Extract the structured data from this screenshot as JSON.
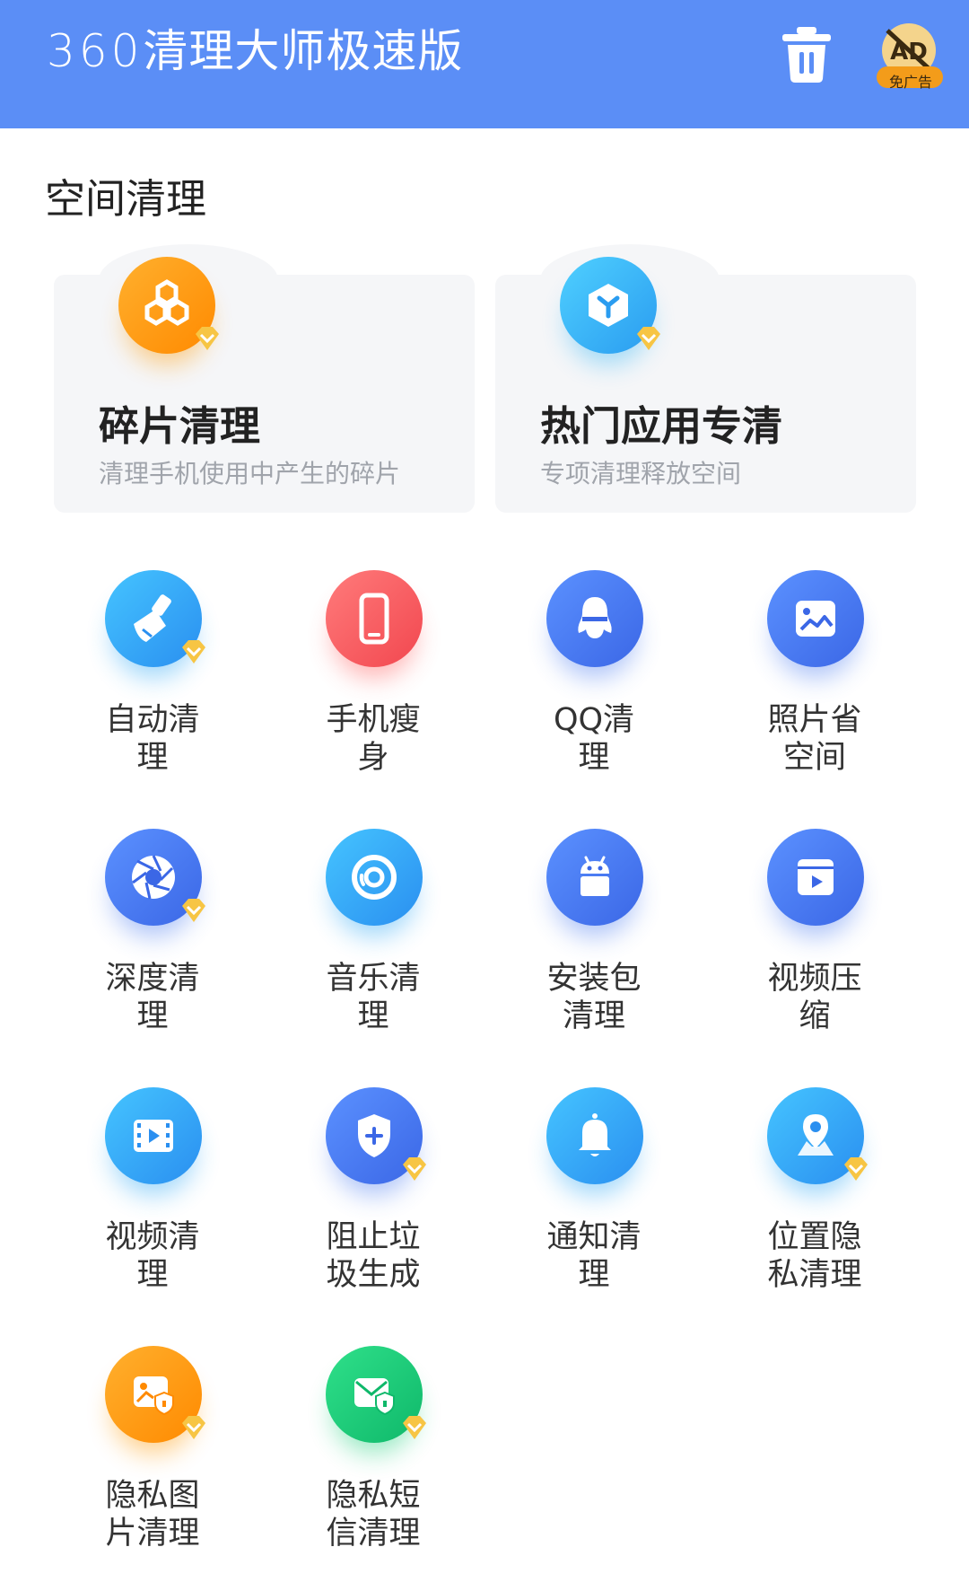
{
  "header": {
    "title_prefix": "360",
    "title_rest": "清理大师极速版",
    "ad_badge_label": "免广告",
    "colors": {
      "bg": "#5b8ef6"
    }
  },
  "section": {
    "title": "空间清理"
  },
  "cards": [
    {
      "title": "碎片清理",
      "subtitle": "清理手机使用中产生的碎片",
      "icon": "honeycomb-icon",
      "color": "#ff9800"
    },
    {
      "title": "热门应用专清",
      "subtitle": "专项清理释放空间",
      "icon": "cube-icon",
      "color": "#36b6f5"
    }
  ],
  "grid": [
    {
      "label_1": "自动清",
      "label_2": "理",
      "icon": "broom-icon",
      "vip": true
    },
    {
      "label_1": "手机瘦",
      "label_2": "身",
      "icon": "phone-icon",
      "vip": false
    },
    {
      "label_1": "QQ清",
      "label_2": "理",
      "icon": "qq-penguin-icon",
      "vip": false
    },
    {
      "label_1": "照片省",
      "label_2": "空间",
      "icon": "image-icon",
      "vip": false
    },
    {
      "label_1": "深度清",
      "label_2": "理",
      "icon": "aperture-icon",
      "vip": true
    },
    {
      "label_1": "音乐清",
      "label_2": "理",
      "icon": "music-disc-icon",
      "vip": false
    },
    {
      "label_1": "安装包",
      "label_2": "清理",
      "icon": "android-package-icon",
      "vip": false
    },
    {
      "label_1": "视频压",
      "label_2": "缩",
      "icon": "video-compress-icon",
      "vip": false
    },
    {
      "label_1": "视频清",
      "label_2": "理",
      "icon": "film-icon",
      "vip": false
    },
    {
      "label_1": "阻止垃",
      "label_2": "圾生成",
      "icon": "shield-plus-icon",
      "vip": true
    },
    {
      "label_1": "通知清",
      "label_2": "理",
      "icon": "bell-icon",
      "vip": false
    },
    {
      "label_1": "位置隐",
      "label_2": "私清理",
      "icon": "location-icon",
      "vip": true
    },
    {
      "label_1": "隐私图",
      "label_2": "片清理",
      "icon": "private-image-icon",
      "vip": true
    },
    {
      "label_1": "隐私短",
      "label_2": "信清理",
      "icon": "private-sms-icon",
      "vip": true
    }
  ]
}
